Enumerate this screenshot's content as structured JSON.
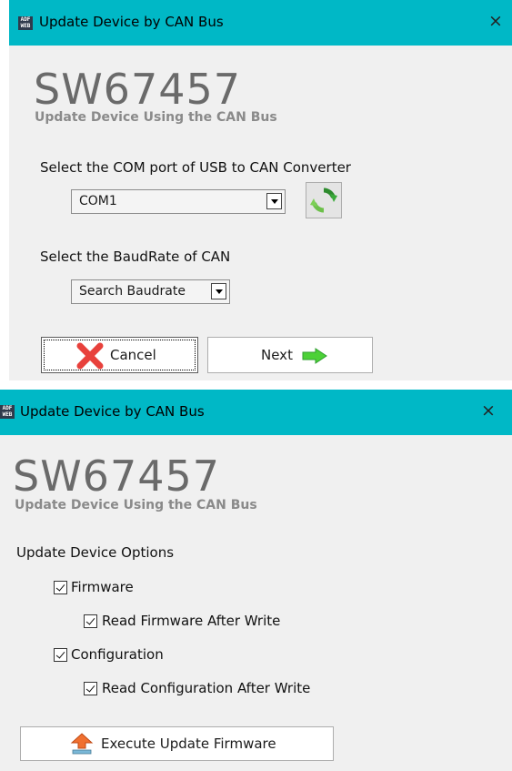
{
  "window1": {
    "title": "Update Device by CAN Bus",
    "product_code": "SW67457",
    "subtitle": "Update Device Using the CAN Bus",
    "com_port_label": "Select the COM port of USB to CAN Converter",
    "com_port_value": "COM1",
    "baudrate_label": "Select the BaudRate of CAN",
    "baudrate_value": "Search Baudrate",
    "cancel_label": "Cancel",
    "next_label": "Next",
    "close_glyph": "×"
  },
  "window2": {
    "title": "Update Device by CAN Bus",
    "product_code": "SW67457",
    "subtitle": "Update Device Using the CAN Bus",
    "options_label": "Update Device Options",
    "firmware_label": "Firmware",
    "firmware_checked": true,
    "read_firmware_label": "Read Firmware After Write",
    "read_firmware_checked": true,
    "configuration_label": "Configuration",
    "configuration_checked": true,
    "read_configuration_label": "Read Configuration After Write",
    "read_configuration_checked": true,
    "execute_label": "Execute Update Firmware",
    "close_glyph": "×"
  },
  "app_icon_text": "ADF WEB",
  "colors": {
    "titlebar": "#00b8c6",
    "window_bg": "#f0f0f0",
    "code_gray": "#6a6a6a",
    "cancel_icon": "#e8413c",
    "next_icon": "#4cd137",
    "refresh_icon": "#3a9a3a",
    "upload_icon": "#f07030"
  },
  "icons": [
    "app-icon",
    "refresh-icon",
    "cancel-x-icon",
    "next-arrow-icon",
    "upload-icon",
    "close-icon",
    "dropdown-arrow-icon",
    "checkbox"
  ]
}
